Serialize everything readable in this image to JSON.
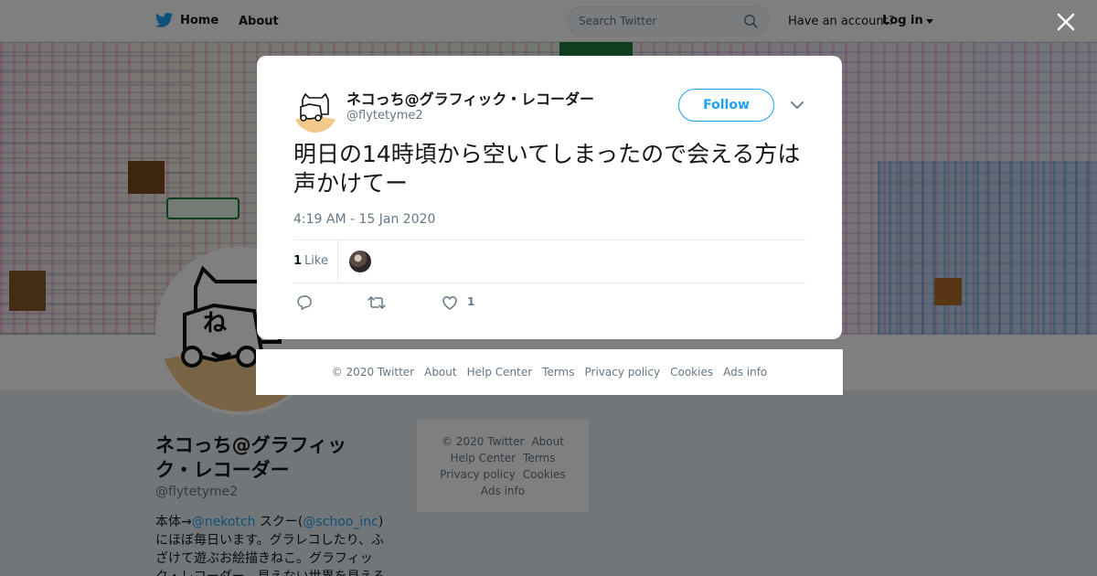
{
  "topbar": {
    "home_label": "Home",
    "about_label": "About",
    "search_placeholder": "Search Twitter",
    "have_account": "Have an account?",
    "login_label": "Log in"
  },
  "profile": {
    "name": "ネコっち@グラフィック・レコーダー",
    "handle": "@flytetyme2",
    "bio_prefix": "本体→",
    "bio_link1": "@nekotch",
    "bio_mid": " スクー(",
    "bio_link2": "@schoo_inc",
    "bio_rest": ")にほぼ毎日います。グラレコしたり、ふざけて遊ぶお絵描きねこ。グラフィック・レコーダー。見えない世界を見える化"
  },
  "side_footer": {
    "copyright": "© 2020 Twitter",
    "about": "About",
    "help": "Help Center",
    "terms": "Terms",
    "privacy": "Privacy policy",
    "cookies": "Cookies",
    "ads": "Ads info"
  },
  "tweet": {
    "author_name": "ネコっち@グラフィック・レコーダー",
    "author_handle": "@flytetyme2",
    "follow_label": "Follow",
    "text": "明日の14時頃から空いてしまったので会える方は声かけてー",
    "timestamp": "4:19 AM - 15 Jan 2020",
    "like_count": "1",
    "like_label": "Like",
    "action_like_count": "1"
  },
  "modal_footer": {
    "copyright": "© 2020 Twitter",
    "about": "About",
    "help": "Help Center",
    "terms": "Terms",
    "privacy": "Privacy policy",
    "cookies": "Cookies",
    "ads": "Ads info"
  },
  "icons": {
    "brand": "twitter-bird-icon",
    "search": "search-icon",
    "close": "close-icon",
    "chevron": "chevron-down-icon",
    "reply": "reply-icon",
    "retweet": "retweet-icon",
    "like": "heart-icon"
  },
  "colors": {
    "accent": "#1da1f2",
    "overlay": "#000000",
    "muted_text": "#657786"
  }
}
